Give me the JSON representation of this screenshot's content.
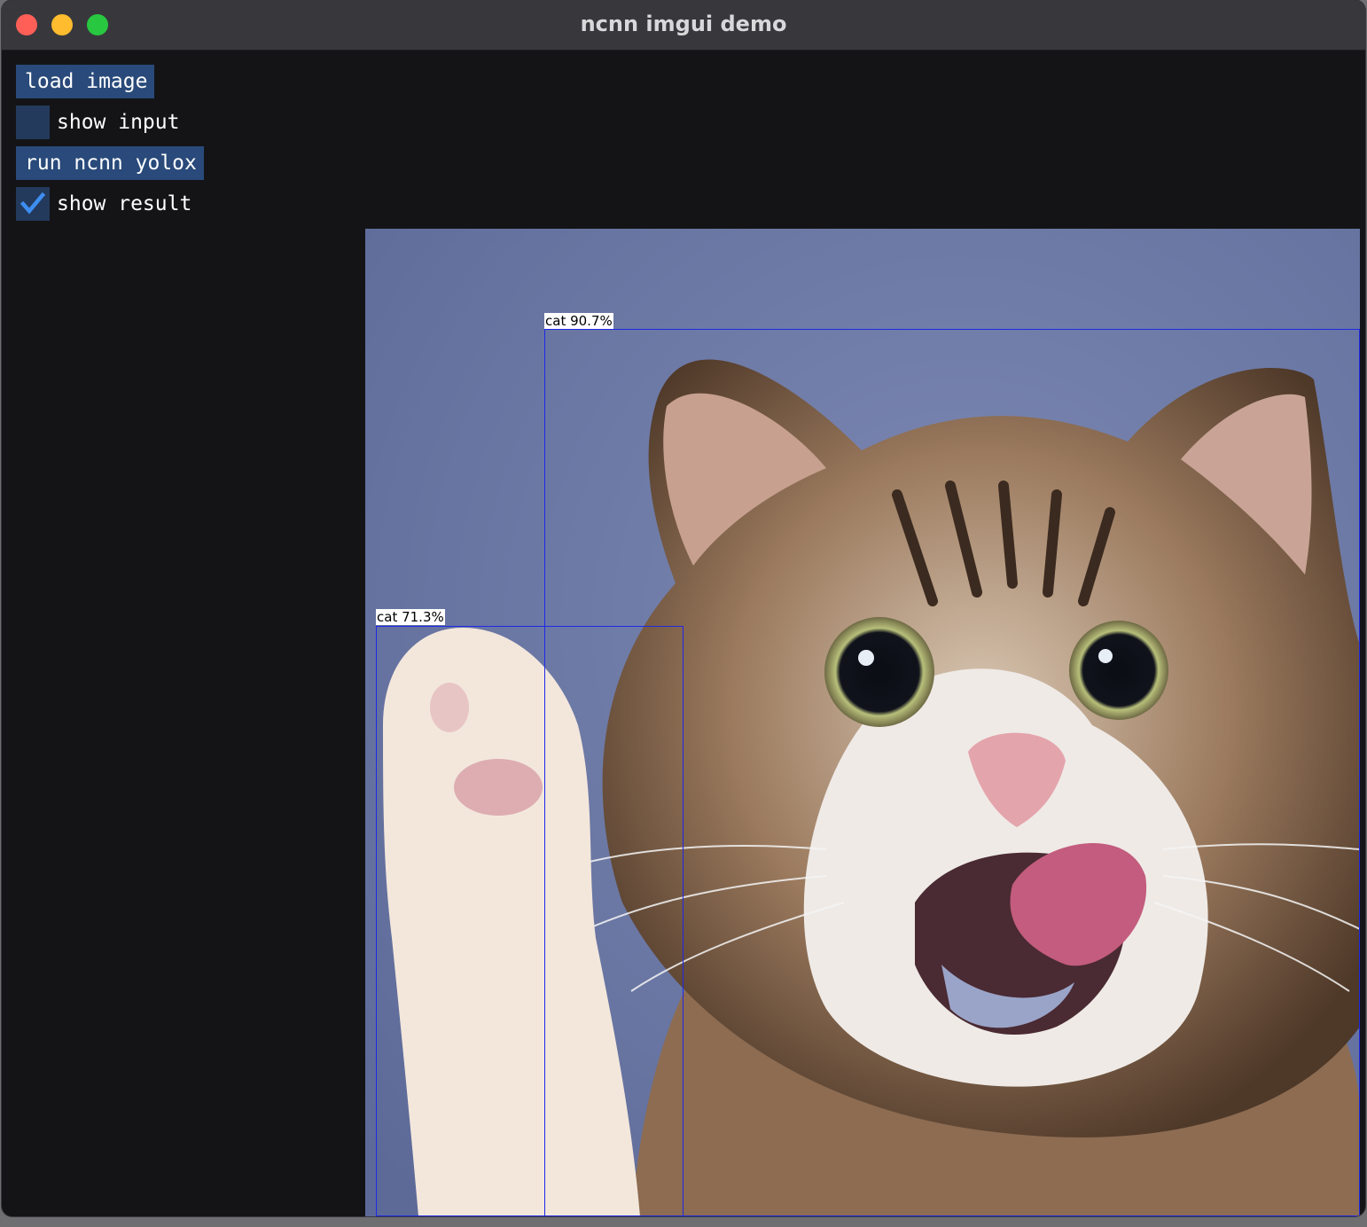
{
  "window": {
    "title": "ncnn imgui demo"
  },
  "controls": {
    "load_image": "load image",
    "show_input": {
      "label": "show input",
      "checked": false
    },
    "run_yolox": "run ncnn yolox",
    "show_result": {
      "label": "show result",
      "checked": true
    }
  },
  "detections": [
    {
      "class": "cat",
      "confidence_label": "cat 90.7%"
    },
    {
      "class": "cat",
      "confidence_label": "cat 71.3%"
    }
  ],
  "colors": {
    "button": "#294a7a",
    "checkbox": "#233a5c",
    "checkmark": "#3d8ef0",
    "detection_box": "#1f28e6",
    "image_background": "#6c7aa6"
  }
}
